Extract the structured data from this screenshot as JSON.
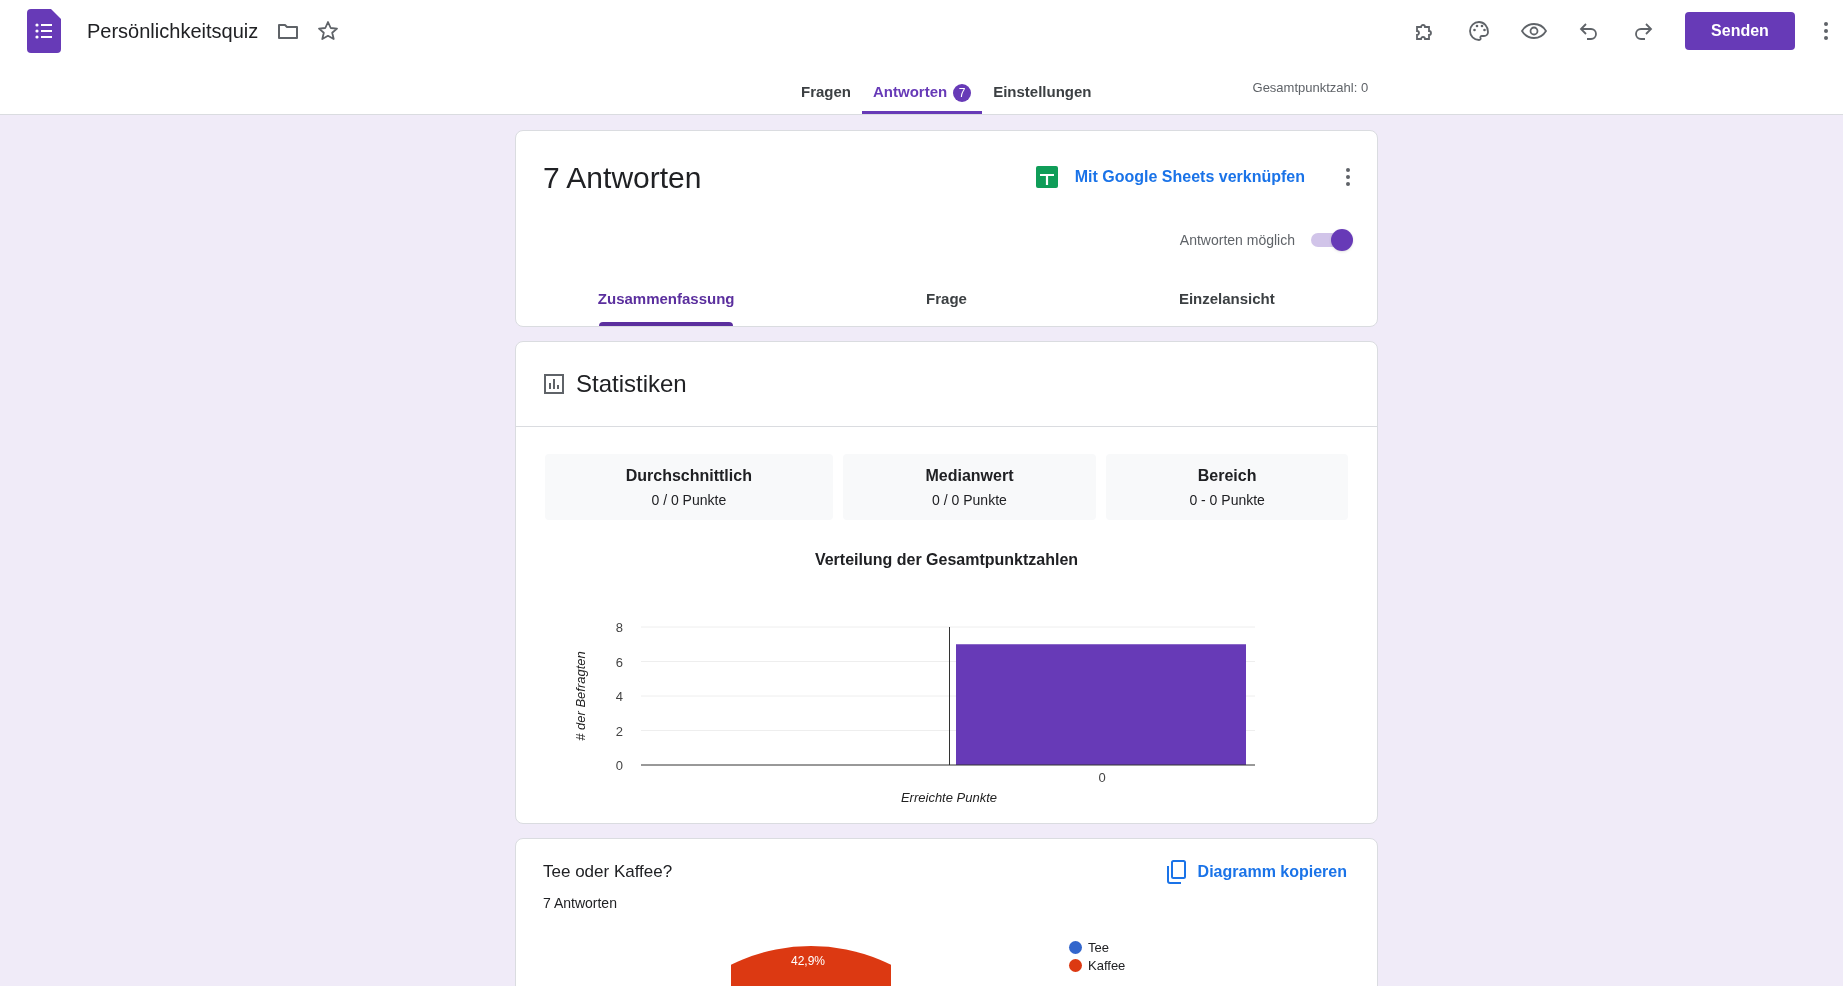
{
  "header": {
    "title": "Persönlichkeitsquiz",
    "send_button": "Senden"
  },
  "tabs": [
    {
      "label": "Fragen",
      "selected": false
    },
    {
      "label": "Antworten",
      "selected": true,
      "badge": "7"
    },
    {
      "label": "Einstellungen",
      "selected": false
    }
  ],
  "total_points": "Gesamtpunktzahl: 0",
  "responses_card": {
    "title": "7 Antworten",
    "sheets_link": "Mit Google Sheets verknüpfen",
    "accepting_label": "Antworten möglich",
    "accepting_on": true,
    "subtabs": [
      {
        "label": "Zusammenfassung",
        "selected": true
      },
      {
        "label": "Frage",
        "selected": false
      },
      {
        "label": "Einzelansicht",
        "selected": false
      }
    ]
  },
  "statistics": {
    "title": "Statistiken",
    "stats": [
      {
        "label": "Durchschnittlich",
        "value": "0 / 0 Punkte"
      },
      {
        "label": "Medianwert",
        "value": "0 / 0 Punkte"
      },
      {
        "label": "Bereich",
        "value": "0 - 0 Punkte"
      }
    ],
    "chart_data": {
      "type": "bar",
      "title": "Verteilung der Gesamtpunktzahlen",
      "xlabel": "Erreichte Punkte",
      "ylabel": "# der Befragten",
      "categories": [
        "0"
      ],
      "series": [
        {
          "color": "#673ab7",
          "values": [
            7
          ]
        }
      ],
      "ylim": [
        0,
        8
      ],
      "yticks": [
        0,
        2,
        4,
        6,
        8
      ],
      "grid": true
    }
  },
  "question": {
    "title": "Tee oder Kaffee?",
    "copy_chart": "Diagramm kopieren",
    "count": "7 Antworten",
    "slice_label": "42,9%",
    "legend": [
      {
        "label": "Tee",
        "color": "#3366cc"
      },
      {
        "label": "Kaffee",
        "color": "#dc3912"
      }
    ]
  }
}
